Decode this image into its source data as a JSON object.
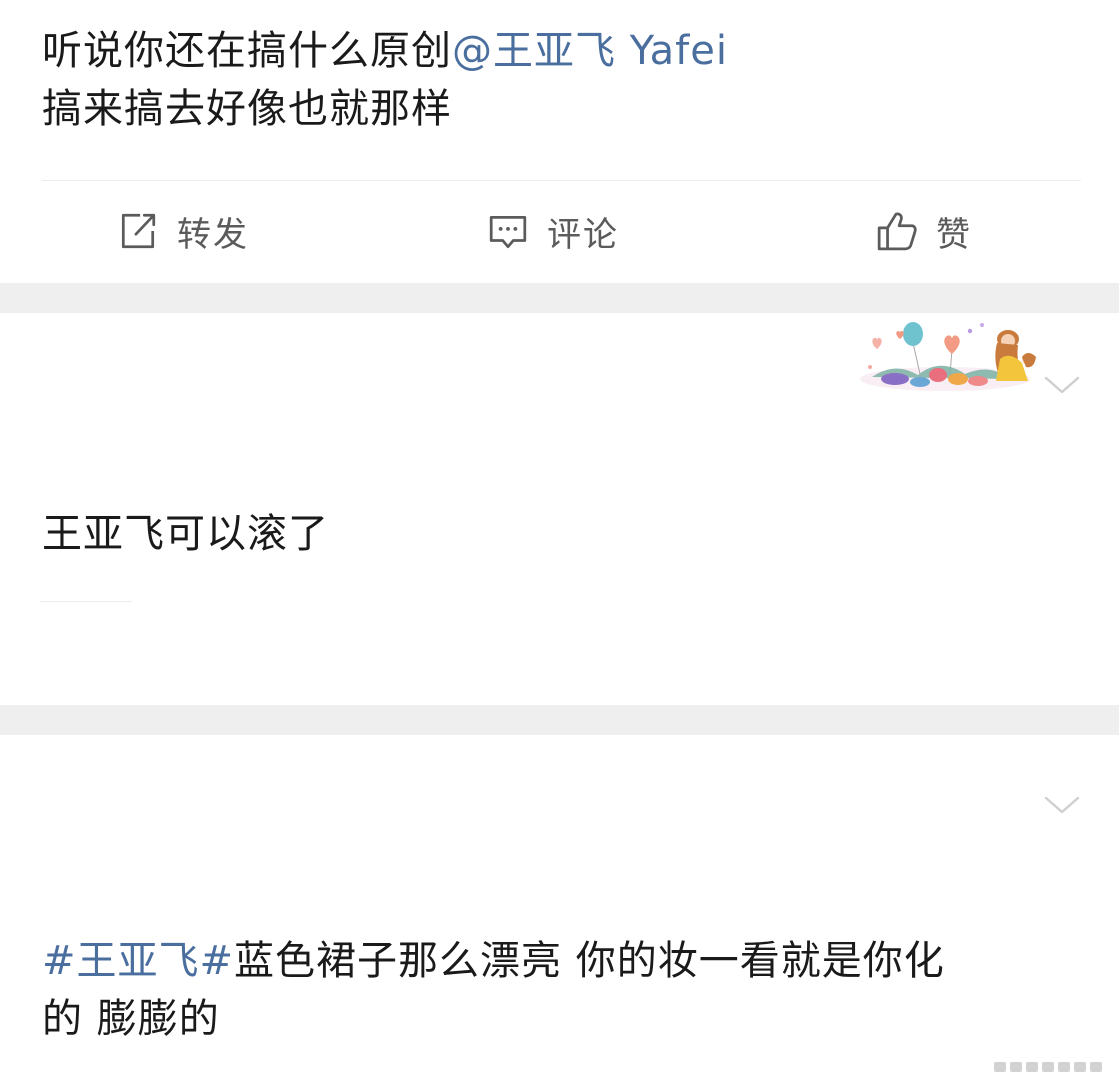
{
  "posts": [
    {
      "text_before": "听说你还在搞什么原创",
      "mention": "@王亚飞 Yafei",
      "text_after": "搞来搞去好像也就那样"
    },
    {
      "text": "王亚飞可以滚了",
      "decoration_icon": "balloons-girl-flowers-decoration"
    },
    {
      "hashtag": "#王亚飞#",
      "text_line1": "蓝色裙子那么漂亮 你的妆一看就是你化",
      "text_line2": "的 膨膨的"
    }
  ],
  "actions": {
    "repost": "转发",
    "comment": "评论",
    "like": "赞"
  },
  "icons": {
    "repost": "share-icon",
    "comment": "comment-icon",
    "like": "thumbs-up-icon",
    "more": "chevron-down-icon"
  },
  "colors": {
    "link": "#4a6f9e",
    "separator": "#efefef",
    "action_text": "#5b5b5b"
  }
}
